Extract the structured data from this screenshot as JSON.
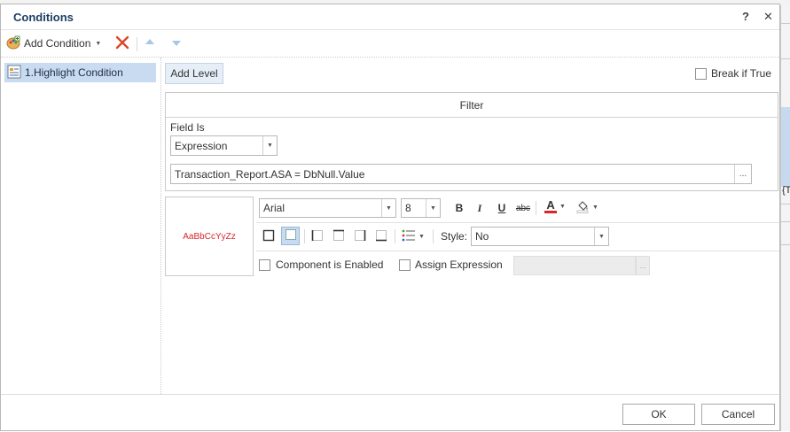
{
  "dialog": {
    "title": "Conditions",
    "help_label": "?",
    "close_label": "✕"
  },
  "toolbar": {
    "add_condition_label": "Add Condition",
    "add_condition_icon": "palette-plus-icon",
    "remove_icon": "red-x-icon",
    "move_up_icon": "arrow-up-icon",
    "move_down_icon": "arrow-down-icon"
  },
  "conditions": [
    {
      "label": "1.Highlight Condition",
      "icon": "highlight-condition-icon",
      "selected": true
    }
  ],
  "main": {
    "add_level_label": "Add Level",
    "break_if_true_label": "Break if True",
    "break_if_true_checked": false
  },
  "filter": {
    "header": "Filter",
    "field_is_label": "Field Is",
    "field_type_value": "Expression",
    "expression_value": "Transaction_Report.ASA = DbNull.Value",
    "expression_button_label": "..."
  },
  "style": {
    "preview_text": "AaBbCcYyZz",
    "preview_color": "#d8262b",
    "font_name": "Arial",
    "font_size": "8",
    "bold_label": "B",
    "italic_label": "I",
    "underline_label": "U",
    "strike_label": "abc",
    "font_color_label": "A",
    "style_label": "Style:",
    "style_value": "No"
  },
  "options": {
    "component_enabled_label": "Component is Enabled",
    "component_enabled_checked": false,
    "assign_expression_label": "Assign Expression",
    "assign_expression_checked": false,
    "assign_button_label": "..."
  },
  "footer": {
    "ok_label": "OK",
    "cancel_label": "Cancel"
  },
  "background": {
    "right_edge_text": "{T"
  },
  "colors": {
    "title": "#1e3f66",
    "selection": "#c9dbf0",
    "remove_red": "#d9472b",
    "font_color_red": "#d8262b"
  }
}
